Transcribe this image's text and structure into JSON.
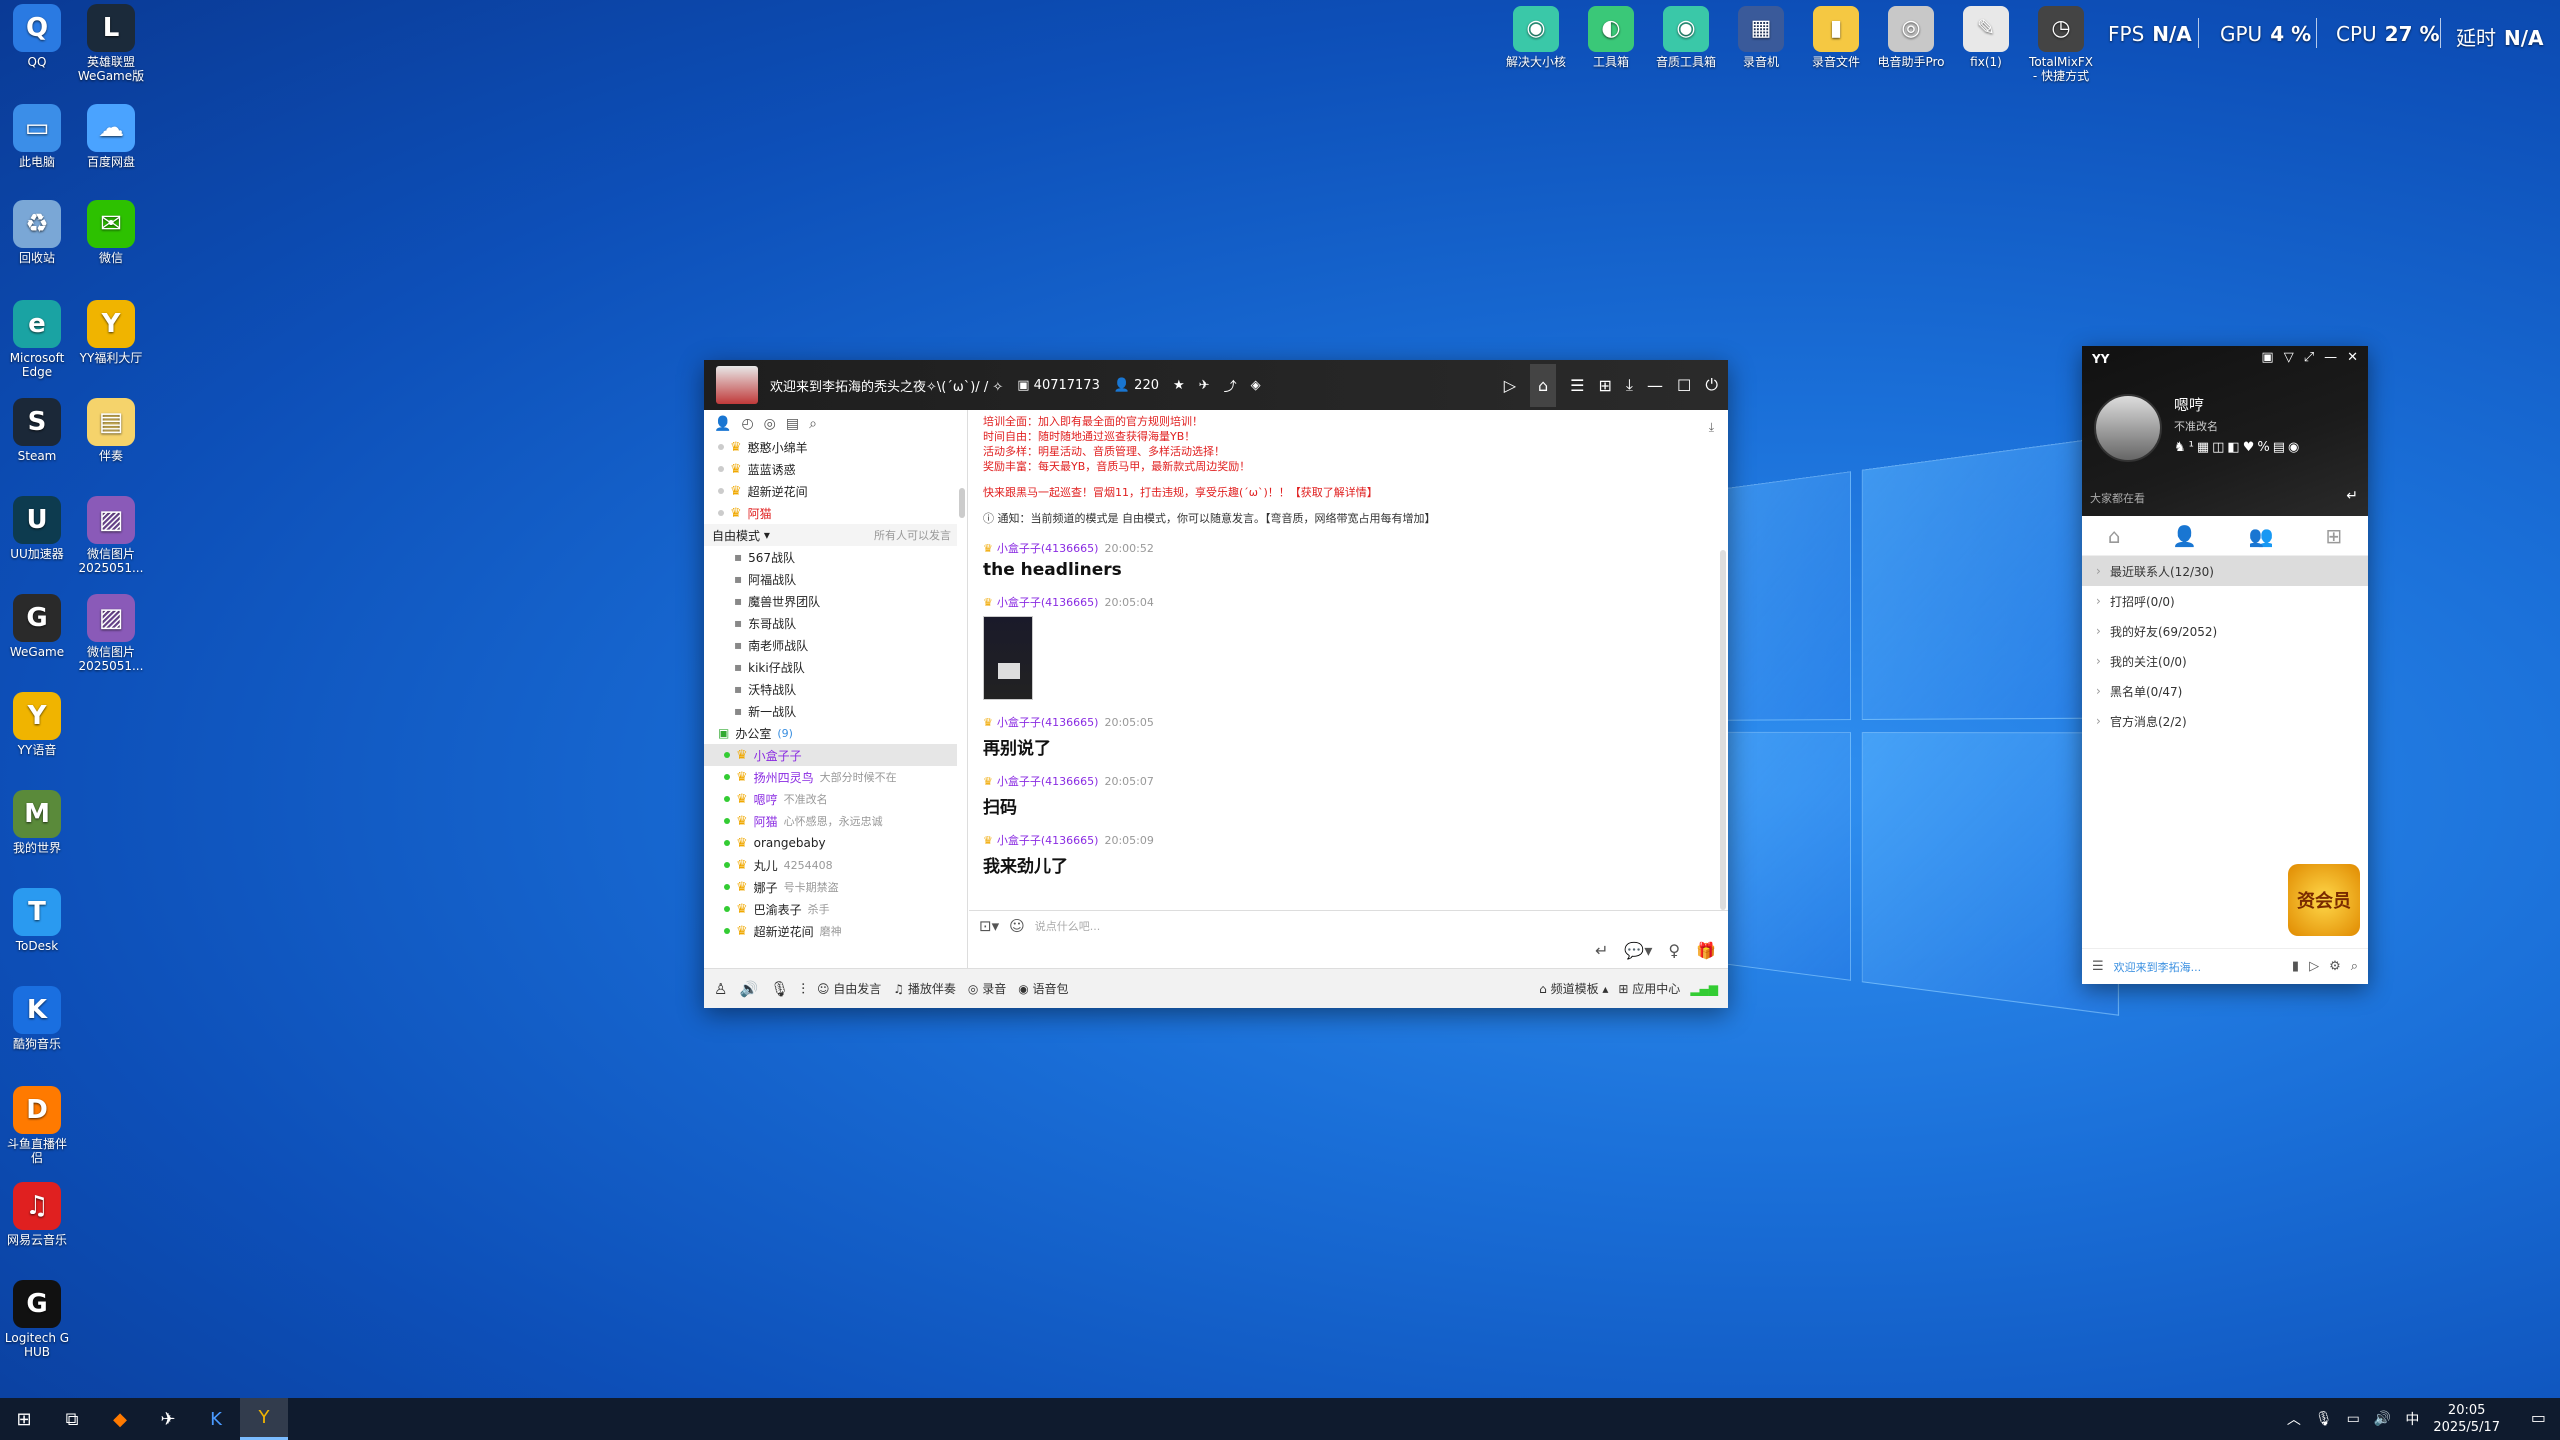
{
  "desktop": {
    "icons": [
      {
        "label": "QQ",
        "icon": "qq-icon",
        "color": "#2a7ae2",
        "glyph": "Q"
      },
      {
        "label": "英雄联盟 WeGame版",
        "icon": "lol-icon",
        "color": "#1b2a3a",
        "glyph": "L"
      },
      {
        "label": "此电脑",
        "icon": "computer-icon",
        "color": "#3b8ee8",
        "glyph": "▭"
      },
      {
        "label": "百度网盘",
        "icon": "baidu-netdisk-icon",
        "color": "#4aa3ff",
        "glyph": "☁"
      },
      {
        "label": "回收站",
        "icon": "recycle-bin-icon",
        "color": "#7aa7d6",
        "glyph": "♻"
      },
      {
        "label": "微信",
        "icon": "wechat-icon",
        "color": "#2dc100",
        "glyph": "✉"
      },
      {
        "label": "Microsoft Edge",
        "icon": "edge-icon",
        "color": "#1aa3a3",
        "glyph": "e"
      },
      {
        "label": "YY福利大厅",
        "icon": "yy-hall-icon",
        "color": "#f0b400",
        "glyph": "Y"
      },
      {
        "label": "Steam",
        "icon": "steam-icon",
        "color": "#1b2838",
        "glyph": "S"
      },
      {
        "label": "伴奏",
        "icon": "folder-icon",
        "color": "#f5d36b",
        "glyph": "▤"
      },
      {
        "label": "UU加速器",
        "icon": "uu-icon",
        "color": "#0d3b4f",
        "glyph": "U"
      },
      {
        "label": "微信图片 2025051...",
        "icon": "image-file-icon",
        "color": "#8a5ab8",
        "glyph": "▨"
      },
      {
        "label": "WeGame",
        "icon": "wegame-icon",
        "color": "#2a2a2a",
        "glyph": "G"
      },
      {
        "label": "微信图片 2025051...",
        "icon": "image-file-icon",
        "color": "#8a5ab8",
        "glyph": "▨"
      },
      {
        "label": "YY语音",
        "icon": "yy-icon",
        "color": "#f0b400",
        "glyph": "Y"
      },
      {
        "label": "我的世界",
        "icon": "minecraft-icon",
        "color": "#5a8a3a",
        "glyph": "M"
      },
      {
        "label": "ToDesk",
        "icon": "todesk-icon",
        "color": "#2a9af0",
        "glyph": "T"
      },
      {
        "label": "酷狗音乐",
        "icon": "kugou-icon",
        "color": "#1a6fe0",
        "glyph": "K"
      },
      {
        "label": "斗鱼直播伴侣",
        "icon": "douyu-icon",
        "color": "#ff7a00",
        "glyph": "D"
      },
      {
        "label": "网易云音乐",
        "icon": "netease-music-icon",
        "color": "#e02020",
        "glyph": "♫"
      },
      {
        "label": "Logitech G HUB",
        "icon": "logitech-icon",
        "color": "#111111",
        "glyph": "G"
      }
    ],
    "top_icons": [
      {
        "label": "解决大小核",
        "icon": "core-tool-icon",
        "color": "#3ac8a8",
        "glyph": "◉"
      },
      {
        "label": "工具箱",
        "icon": "toolbox-icon",
        "color": "#3ac878",
        "glyph": "◐"
      },
      {
        "label": "音质工具箱",
        "icon": "audio-toolbox-icon",
        "color": "#3ac8a8",
        "glyph": "◉"
      },
      {
        "label": "录音机",
        "icon": "recorder-icon",
        "color": "#3a5a9a",
        "glyph": "▦"
      },
      {
        "label": "录音文件",
        "icon": "folder-icon",
        "color": "#f5c842",
        "glyph": "▮"
      },
      {
        "label": "电音助手Pro",
        "icon": "cd-icon",
        "color": "#c8c8c8",
        "glyph": "◎"
      },
      {
        "label": "fix(1)",
        "icon": "fix-tool-icon",
        "color": "#e8e8e8",
        "glyph": "✎"
      },
      {
        "label": "TotalMixFX - 快捷方式",
        "icon": "totalmix-icon",
        "color": "#444444",
        "glyph": "◷"
      }
    ]
  },
  "perf": {
    "fps_label": "FPS",
    "fps_value": "N/A",
    "gpu_label": "GPU",
    "gpu_value": "4 %",
    "cpu_label": "CPU",
    "cpu_value": "27 %",
    "latency_label": "延时",
    "latency_value": "N/A"
  },
  "yy": {
    "channel_title": "欢迎来到李拓海的秃头之夜✧\\(ˊωˋ)/ / ✧",
    "channel_id": "40717173",
    "online_count": "220",
    "tree": [
      {
        "label": "憨憨小绵羊",
        "type": "user"
      },
      {
        "label": "蓝蓝诱惑",
        "type": "user"
      },
      {
        "label": "超新逆花间",
        "type": "user"
      },
      {
        "label": "阿猫",
        "type": "user",
        "red": true
      }
    ],
    "mode_label": "自由模式",
    "mode_note": "所有人可以发言",
    "subchannels": [
      "567战队",
      "阿福战队",
      "魔兽世界团队",
      "东哥战队",
      "南老师战队",
      "kiki仔战队",
      "沃特战队",
      "新一战队"
    ],
    "office_label": "办公室",
    "office_count": "(9)",
    "office_users": [
      {
        "name": "小盒子子",
        "sub": "",
        "sel": true
      },
      {
        "name": "扬州四灵鸟",
        "sub": "大部分时候不在"
      },
      {
        "name": "嗯哼",
        "sub": "不准改名"
      },
      {
        "name": "阿猫",
        "sub": "心怀感恩，永远忠诚"
      },
      {
        "name": "orangebaby",
        "sub": ""
      },
      {
        "name": "丸儿",
        "sub": "4254408"
      },
      {
        "name": "娜子",
        "sub": "号卡期禁盗"
      },
      {
        "name": "巴渝表子",
        "sub": "杀手"
      },
      {
        "name": "超新逆花间",
        "sub": "磨神"
      }
    ],
    "notice_lines": [
      "培训全面：加入即有最全面的官方规则培训！",
      "时间自由：随时随地通过巡查获得海量YB！",
      "活动多样：明星活动、音质管理、多样活动选择！",
      "奖励丰富：每天最YB，音质马甲，最新款式周边奖励！"
    ],
    "notice2": "快来跟黑马一起巡查！冒烟11，打击违规，享受乐趣(ˊωˋ)！！【获取了解详情】",
    "notice3": "通知：当前频道的模式是 自由模式，你可以随意发言。【弯音质，网络带宽占用每有增加】",
    "messages": [
      {
        "user": "小盒子子",
        "id": "(4136665)",
        "time": "20:00:52",
        "text": "the headliners",
        "image": false
      },
      {
        "user": "小盒子子",
        "id": "(4136665)",
        "time": "20:05:04",
        "text": "",
        "image": true
      },
      {
        "user": "小盒子子",
        "id": "(4136665)",
        "time": "20:05:05",
        "text": "再别说了",
        "image": false
      },
      {
        "user": "小盒子子",
        "id": "(4136665)",
        "time": "20:05:07",
        "text": "扫码",
        "image": false
      },
      {
        "user": "小盒子子",
        "id": "(4136665)",
        "time": "20:05:09",
        "text": "我来劲儿了",
        "image": false
      }
    ],
    "input_placeholder": "说点什么吧...",
    "bottom": {
      "free_speak": "自由发言",
      "play_music": "播放伴奏",
      "record": "录音",
      "voice_pack": "语音包",
      "channel_template": "频道模板",
      "app_center": "应用中心"
    }
  },
  "panel": {
    "brand": "YY",
    "name": "嗯哼",
    "signature": "不准改名",
    "watching": "大家都在看",
    "items": [
      {
        "label": "最近联系人(12/30)",
        "sel": true
      },
      {
        "label": "打招呼(0/0)"
      },
      {
        "label": "我的好友(69/2052)"
      },
      {
        "label": "我的关注(0/0)"
      },
      {
        "label": "黑名单(0/47)"
      },
      {
        "label": "官方消息(2/2)"
      }
    ],
    "mascot_text": "资会员",
    "bottom_link": "欢迎来到李拓海..."
  },
  "taskbar": {
    "time": "20:05",
    "date": "2025/5/17",
    "ime": "中"
  }
}
